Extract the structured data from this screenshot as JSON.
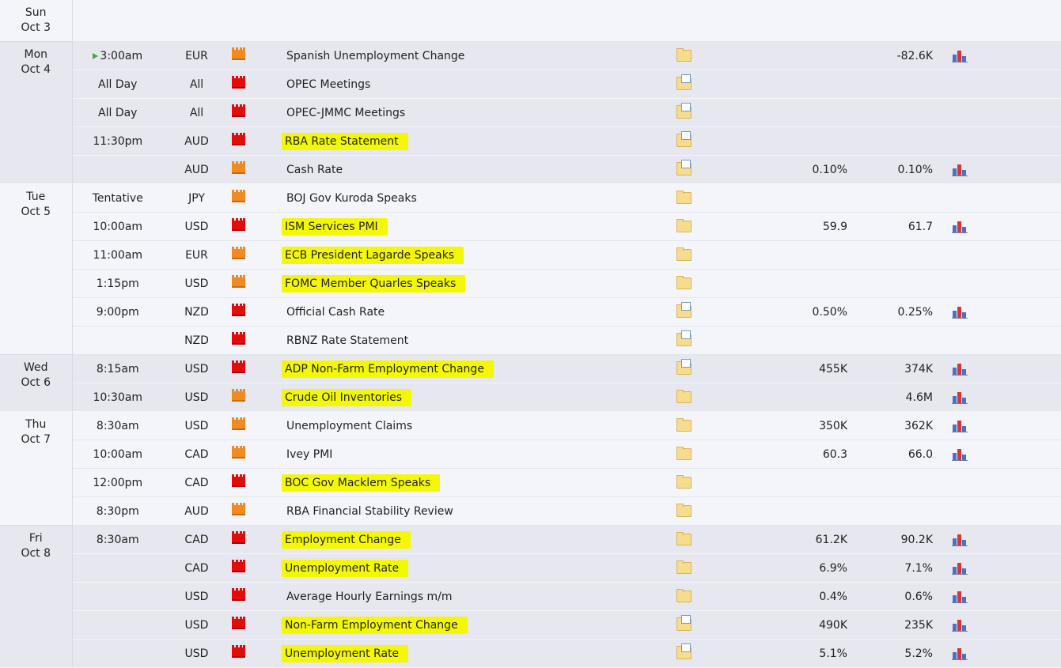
{
  "days": [
    {
      "weekday": "Sun",
      "date": "Oct 3",
      "events": []
    },
    {
      "weekday": "Mon",
      "date": "Oct 4",
      "events": [
        {
          "time": "3:00am",
          "playing": true,
          "currency": "EUR",
          "impact": "med",
          "event": "Spanish Unemployment Change",
          "highlight": false,
          "detail": "folder",
          "actual": "",
          "forecast": "",
          "previous": "-82.6K",
          "graph": true
        },
        {
          "time": "All Day",
          "currency": "All",
          "impact": "high",
          "event": "OPEC Meetings",
          "highlight": false,
          "detail": "doc",
          "actual": "",
          "forecast": "",
          "previous": "",
          "graph": false
        },
        {
          "time": "All Day",
          "currency": "All",
          "impact": "high",
          "event": "OPEC-JMMC Meetings",
          "highlight": false,
          "detail": "doc",
          "actual": "",
          "forecast": "",
          "previous": "",
          "graph": false
        },
        {
          "time": "11:30pm",
          "currency": "AUD",
          "impact": "high",
          "event": "RBA Rate Statement",
          "highlight": true,
          "detail": "doc",
          "actual": "",
          "forecast": "",
          "previous": "",
          "graph": false
        },
        {
          "time": "",
          "currency": "AUD",
          "impact": "med",
          "event": "Cash Rate",
          "highlight": false,
          "detail": "doc",
          "actual": "",
          "forecast": "0.10%",
          "previous": "0.10%",
          "graph": true
        }
      ]
    },
    {
      "weekday": "Tue",
      "date": "Oct 5",
      "events": [
        {
          "time": "Tentative",
          "currency": "JPY",
          "impact": "med",
          "event": "BOJ Gov Kuroda Speaks",
          "highlight": false,
          "detail": "folder",
          "actual": "",
          "forecast": "",
          "previous": "",
          "graph": false
        },
        {
          "time": "10:00am",
          "currency": "USD",
          "impact": "high",
          "event": "ISM Services PMI",
          "highlight": true,
          "detail": "folder",
          "actual": "",
          "forecast": "59.9",
          "previous": "61.7",
          "graph": true
        },
        {
          "time": "11:00am",
          "currency": "EUR",
          "impact": "med",
          "event": "ECB President Lagarde Speaks",
          "highlight": true,
          "detail": "folder",
          "actual": "",
          "forecast": "",
          "previous": "",
          "graph": false
        },
        {
          "time": "1:15pm",
          "currency": "USD",
          "impact": "med",
          "event": "FOMC Member Quarles Speaks",
          "highlight": true,
          "detail": "folder",
          "actual": "",
          "forecast": "",
          "previous": "",
          "graph": false
        },
        {
          "time": "9:00pm",
          "currency": "NZD",
          "impact": "high",
          "event": "Official Cash Rate",
          "highlight": false,
          "detail": "doc",
          "actual": "",
          "forecast": "0.50%",
          "previous": "0.25%",
          "graph": true
        },
        {
          "time": "",
          "currency": "NZD",
          "impact": "high",
          "event": "RBNZ Rate Statement",
          "highlight": false,
          "detail": "doc",
          "actual": "",
          "forecast": "",
          "previous": "",
          "graph": false
        }
      ]
    },
    {
      "weekday": "Wed",
      "date": "Oct 6",
      "events": [
        {
          "time": "8:15am",
          "currency": "USD",
          "impact": "high",
          "event": "ADP Non-Farm Employment Change",
          "highlight": true,
          "detail": "doc",
          "actual": "",
          "forecast": "455K",
          "previous": "374K",
          "graph": true
        },
        {
          "time": "10:30am",
          "currency": "USD",
          "impact": "med",
          "event": "Crude Oil Inventories",
          "highlight": true,
          "detail": "folder",
          "actual": "",
          "forecast": "",
          "previous": "4.6M",
          "graph": true
        }
      ]
    },
    {
      "weekday": "Thu",
      "date": "Oct 7",
      "events": [
        {
          "time": "8:30am",
          "currency": "USD",
          "impact": "med",
          "event": "Unemployment Claims",
          "highlight": false,
          "detail": "folder",
          "actual": "",
          "forecast": "350K",
          "previous": "362K",
          "graph": true
        },
        {
          "time": "10:00am",
          "currency": "CAD",
          "impact": "med",
          "event": "Ivey PMI",
          "highlight": false,
          "detail": "folder",
          "actual": "",
          "forecast": "60.3",
          "previous": "66.0",
          "graph": true
        },
        {
          "time": "12:00pm",
          "currency": "CAD",
          "impact": "high",
          "event": "BOC Gov Macklem Speaks",
          "highlight": true,
          "detail": "folder",
          "actual": "",
          "forecast": "",
          "previous": "",
          "graph": false
        },
        {
          "time": "8:30pm",
          "currency": "AUD",
          "impact": "med",
          "event": "RBA Financial Stability Review",
          "highlight": false,
          "detail": "folder",
          "actual": "",
          "forecast": "",
          "previous": "",
          "graph": false
        }
      ]
    },
    {
      "weekday": "Fri",
      "date": "Oct 8",
      "events": [
        {
          "time": "8:30am",
          "currency": "CAD",
          "impact": "high",
          "event": "Employment Change",
          "highlight": true,
          "detail": "folder",
          "actual": "",
          "forecast": "61.2K",
          "previous": "90.2K",
          "graph": true
        },
        {
          "time": "",
          "currency": "CAD",
          "impact": "high",
          "event": "Unemployment Rate",
          "highlight": true,
          "detail": "folder",
          "actual": "",
          "forecast": "6.9%",
          "previous": "7.1%",
          "graph": true
        },
        {
          "time": "",
          "currency": "USD",
          "impact": "high",
          "event": "Average Hourly Earnings m/m",
          "highlight": false,
          "detail": "folder",
          "actual": "",
          "forecast": "0.4%",
          "previous": "0.6%",
          "graph": true
        },
        {
          "time": "",
          "currency": "USD",
          "impact": "high",
          "event": "Non-Farm Employment Change",
          "highlight": true,
          "detail": "doc",
          "actual": "",
          "forecast": "490K",
          "previous": "235K",
          "graph": true
        },
        {
          "time": "",
          "currency": "USD",
          "impact": "high",
          "event": "Unemployment Rate",
          "highlight": true,
          "detail": "doc",
          "actual": "",
          "forecast": "5.1%",
          "previous": "5.2%",
          "graph": true
        }
      ]
    }
  ],
  "icons": {
    "impact_high": "high-impact-icon",
    "impact_med": "medium-impact-icon",
    "detail": "folder-icon",
    "graph": "graph-icon",
    "play": "play-icon"
  },
  "colors": {
    "highlight": "#f4f800",
    "impact_high": "#e30b0b",
    "impact_med": "#f08a22",
    "row_alt": "#e6e7ef",
    "row": "#f4f5fb"
  }
}
